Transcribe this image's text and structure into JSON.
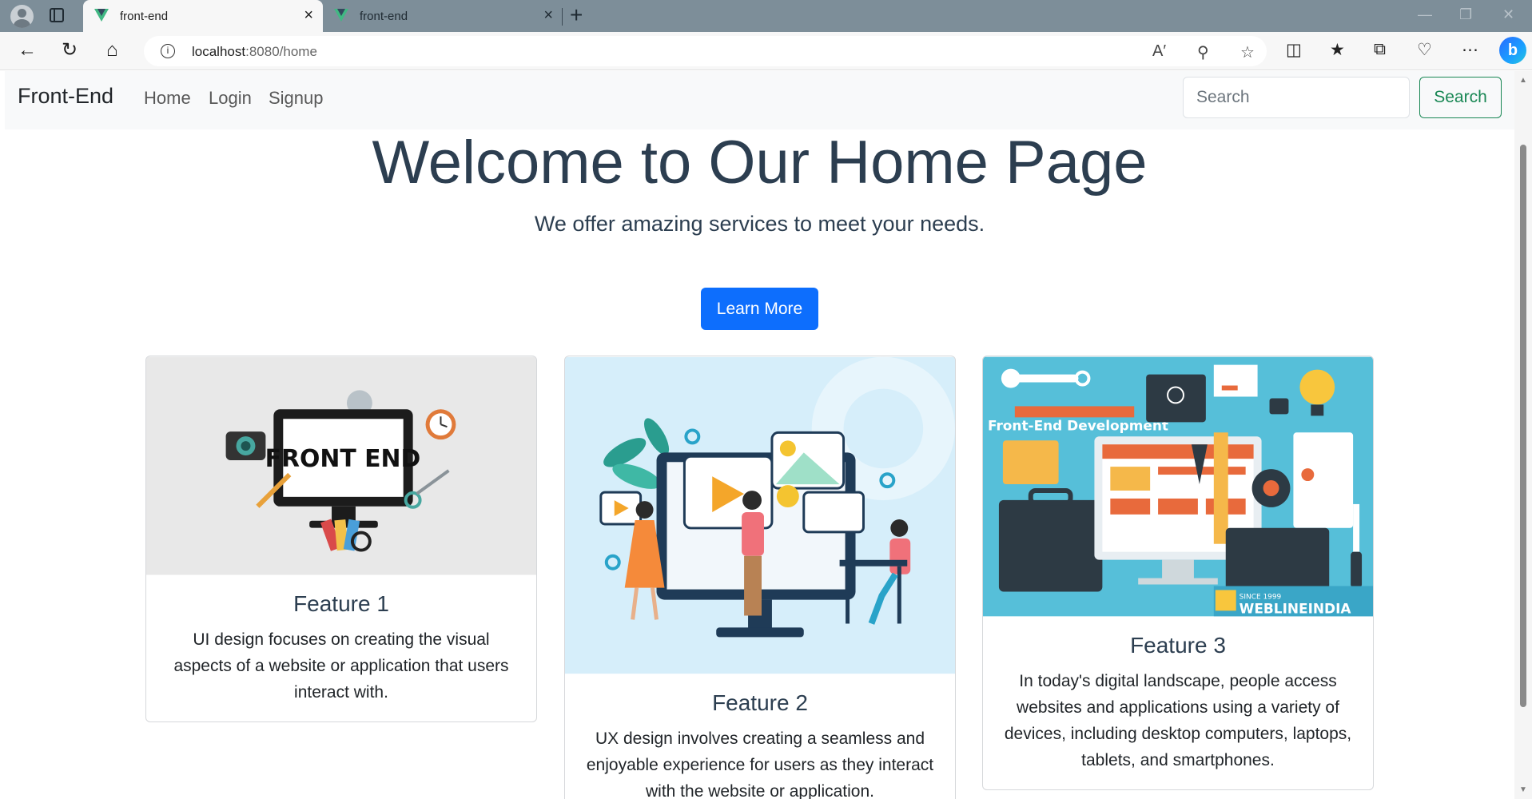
{
  "browser": {
    "tabs": [
      {
        "title": "front-end",
        "close_icon": "×"
      },
      {
        "title": "front-end",
        "close_icon": "×"
      }
    ],
    "new_tab_icon": "+",
    "address_host": "localhost",
    "address_path": ":8080/home"
  },
  "navbar": {
    "brand": "Front-End",
    "links": [
      "Home",
      "Login",
      "Signup"
    ],
    "search_placeholder": "Search",
    "search_button": "Search"
  },
  "hero": {
    "title": "Welcome to Our Home Page",
    "subtitle": "We offer amazing services to meet your needs.",
    "button": "Learn More"
  },
  "cards": [
    {
      "title": "Feature 1",
      "text": "UI design focuses on creating the visual aspects of a website or application that users interact with.",
      "image_caption": "FRONT END"
    },
    {
      "title": "Feature 2",
      "text": "UX design involves creating a seamless and enjoyable experience for users as they interact with the website or application.",
      "image_caption": ""
    },
    {
      "title": "Feature 3",
      "text": "In today's digital landscape, people access websites and applications using a variety of devices, including desktop computers, laptops, tablets, and smartphones.",
      "image_caption": "Front-End Development",
      "image_badge_small": "SINCE 1999",
      "image_badge": "WEBLINEINDIA"
    }
  ],
  "colors": {
    "primary": "#0d6efd",
    "success": "#198754",
    "heading": "#2c3e50"
  }
}
